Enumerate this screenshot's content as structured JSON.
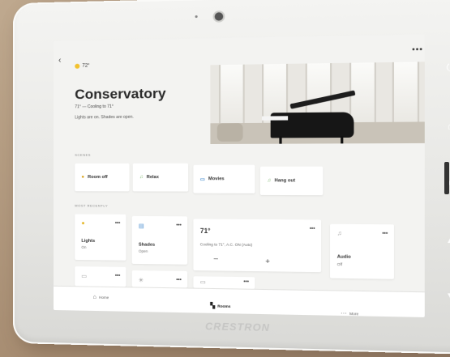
{
  "screen": {
    "back_icon": "chevron-left-icon",
    "more_label": "•••",
    "weather": {
      "icon": "sun-icon",
      "temp": "72°"
    },
    "room": {
      "title": "Conservatory",
      "status": "71° — Cooling to 71°",
      "summary": "Lights are on. Shades are open."
    }
  },
  "scenes": {
    "label": "Scenes",
    "items": [
      {
        "label": "Room off",
        "icon": "sun-icon",
        "icon_color": "#d9a21a"
      },
      {
        "label": "Relax",
        "icon": "music-icon",
        "icon_color": "#7bb56a"
      },
      {
        "label": "Movies",
        "icon": "tv-icon",
        "icon_color": "#4c8fd0"
      },
      {
        "label": "Hang out",
        "icon": "music-icon",
        "icon_color": "#7bb56a"
      }
    ]
  },
  "devices": {
    "label": "Most recently",
    "lights": {
      "name": "Lights",
      "state": "On",
      "more": "•••"
    },
    "shades": {
      "name": "Shades",
      "state": "Open",
      "more": "•••"
    },
    "thermostat": {
      "temp": "71°",
      "info": "Cooling to 71°, A.C. ON (Auto)",
      "minus": "–",
      "plus": "+",
      "more": "•••"
    },
    "audio": {
      "name": "Audio",
      "state": "Off",
      "more": "•••"
    },
    "row2_more": "•••"
  },
  "nav": {
    "home": "Home",
    "rooms": "Rooms",
    "more": "More"
  },
  "brand": "CRESTRON",
  "colors": {
    "accent_yellow": "#f2c12e",
    "screen_bg": "#f3f3f1"
  }
}
